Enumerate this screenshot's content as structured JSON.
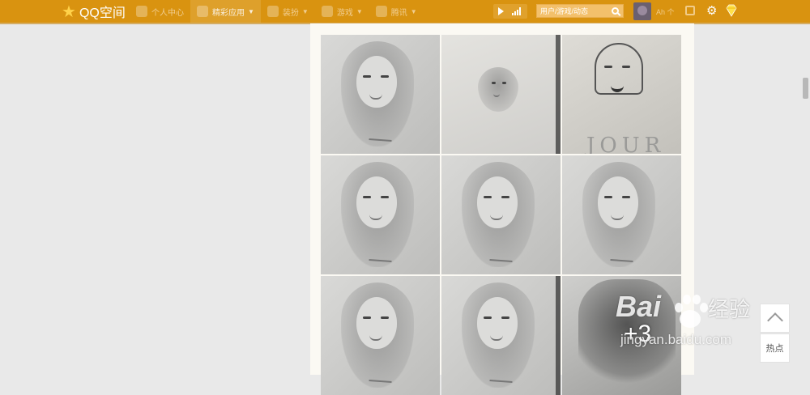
{
  "header": {
    "logo_text": "QQ空间",
    "nav": [
      {
        "label": "个人中心",
        "icon": "user-icon",
        "active": false
      },
      {
        "label": "精彩应用",
        "icon": "apps-icon",
        "active": true
      },
      {
        "label": "装扮",
        "icon": "dress-icon",
        "active": false
      },
      {
        "label": "游戏",
        "icon": "game-icon",
        "active": false
      },
      {
        "label": "腾讯",
        "icon": "shield-icon",
        "active": false
      }
    ],
    "search_placeholder": "用户/游戏/动态",
    "username": "Ah 个"
  },
  "photos": {
    "grid": [
      {
        "alt": "pencil portrait 1"
      },
      {
        "alt": "pencil sketch 2"
      },
      {
        "alt": "pencil portrait 3",
        "caption": "JOUR"
      },
      {
        "alt": "pencil portrait 4"
      },
      {
        "alt": "pencil portrait 5"
      },
      {
        "alt": "pencil portrait 6"
      },
      {
        "alt": "pencil portrait 7"
      },
      {
        "alt": "pencil portrait 8"
      },
      {
        "alt": "pencil portrait 9"
      }
    ],
    "more_count": "+3"
  },
  "watermark": {
    "brand_latin": "Bai",
    "brand_cn": "经验",
    "url": "jingyan.baidu.com"
  },
  "side_tools": {
    "hot_label": "热点"
  },
  "colors": {
    "topbar": "#d99310",
    "content_bg": "#fbf9f3",
    "page_bg": "#e9e9e9"
  }
}
